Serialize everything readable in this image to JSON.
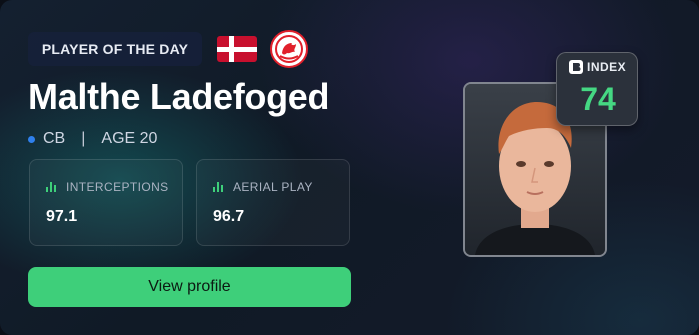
{
  "card": {
    "badge_label": "PLAYER OF THE DAY",
    "player_name": "Malthe Ladefoged",
    "position": "CB",
    "separator": "|",
    "age": "AGE 20",
    "nationality_flag": "denmark-flag-icon",
    "club_logo": "club-crest-icon"
  },
  "stats": [
    {
      "label": "INTERCEPTIONS",
      "value": "97.1"
    },
    {
      "label": "AERIAL PLAY",
      "value": "96.7"
    }
  ],
  "cta": {
    "label": "View profile"
  },
  "index": {
    "label": "INDEX",
    "value": "74"
  },
  "colors": {
    "accent_green": "#3ecf7a",
    "index_green": "#45d883",
    "position_dot": "#2f80ed",
    "flag_red": "#c8102e"
  }
}
